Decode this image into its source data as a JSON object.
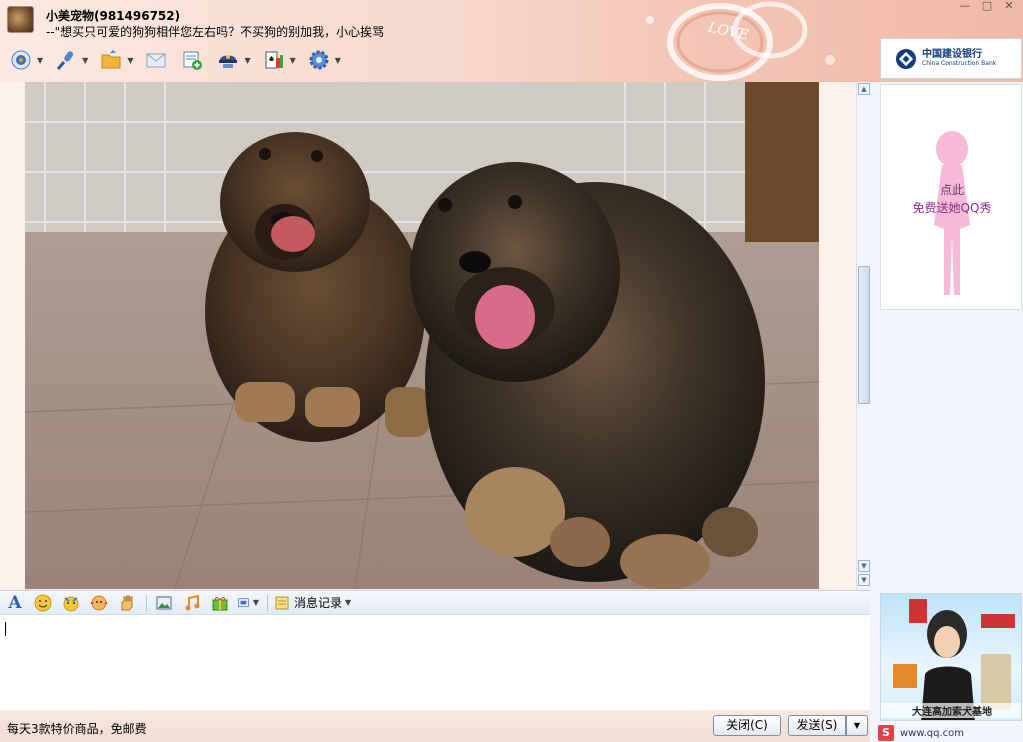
{
  "contact": {
    "name": "小美宠物(981496752)",
    "signature": "--\"想买只可爱的狗狗相伴您左右吗？不买狗的别加我，小心挨骂"
  },
  "window_controls": {
    "minimize": "—",
    "maximize": "□",
    "close": "✕"
  },
  "header_deco_text": "LOVE",
  "toolbar": {
    "items": [
      {
        "name": "video-chat",
        "icon": "camera-icon"
      },
      {
        "name": "voice-chat",
        "icon": "microphone-icon"
      },
      {
        "name": "send-file",
        "icon": "folder-icon"
      },
      {
        "name": "send-message-mail",
        "icon": "envelope-icon"
      },
      {
        "name": "application-share",
        "icon": "app-share-icon"
      },
      {
        "name": "qq-show",
        "icon": "captain-hat-icon"
      },
      {
        "name": "games",
        "icon": "cards-icon"
      },
      {
        "name": "settings",
        "icon": "gear-icon"
      }
    ]
  },
  "sidebar": {
    "bank_ad": {
      "name_cn": "中国建设银行",
      "name_en": "China Construction Bank"
    },
    "qqshow": {
      "line1": "点此",
      "line2": "免费送她QQ秀"
    },
    "ad_caption": "大连高加索犬基地",
    "tray_text": "www.qq.com"
  },
  "input_toolbar": {
    "font_label": "A",
    "history_label": "消息记录"
  },
  "footer": {
    "promo": "每天3款特价商品，免邮费",
    "close_label": "关闭(C)",
    "send_label": "发送(S)",
    "send_arrow": "▼"
  },
  "colors": {
    "accent_blue": "#2b5fb0",
    "header_pink": "#f3c4b4",
    "bank_blue": "#123d7a"
  }
}
